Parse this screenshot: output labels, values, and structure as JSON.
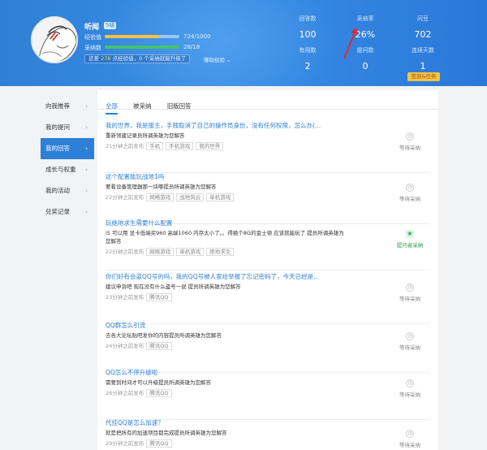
{
  "profile": {
    "username": "听闻",
    "level": "5级",
    "exp_label": "经验值",
    "exp_value": "724/1000",
    "exp_fraction": 0.724,
    "accept_label": "采纳数",
    "accept_value": "28/18",
    "accept_fraction": 1.0,
    "tip_prefix": "还差",
    "tip_number": "276",
    "tip_suffix": "点经验值，0 个采纳就能升级了",
    "tip_link": "赚取经验 ⌄"
  },
  "stats": [
    {
      "label": "回答数",
      "value": "100"
    },
    {
      "label": "采纳率",
      "value": "26%"
    },
    {
      "label": "问豆",
      "value": "702"
    },
    {
      "label": "有用数",
      "value": "2"
    },
    {
      "label": "提问数",
      "value": "0"
    },
    {
      "label": "连续天数",
      "value": "1"
    }
  ],
  "checkin_label": "签到&任务",
  "sidebar": [
    {
      "label": "向我推荐"
    },
    {
      "label": "我的提问"
    },
    {
      "label": "我的回答"
    },
    {
      "label": "成长与权重"
    },
    {
      "label": "我的活动"
    },
    {
      "label": "兑奖记录"
    }
  ],
  "tabs": [
    {
      "label": "全部"
    },
    {
      "label": "被采纳"
    },
    {
      "label": "旧版回答"
    }
  ],
  "questions": [
    {
      "title": "我的世界，我是服主，手贱取消了自己的操作员身份，没有任何权限，怎么办(...",
      "body": "重新领建记录员所调英雄为您解答",
      "time": "21分钟之前发布",
      "tags": [
        "手机",
        "手机游戏",
        "我的世界"
      ],
      "status": "等待采纳",
      "status_icon": "clock-icon",
      "accepted": false
    },
    {
      "title": "这个配置能玩战地1吗",
      "body": "要看设备管理器那一块哪提员所调英雄为您解答",
      "time": "22分钟之前发布",
      "tags": [
        "网络游戏",
        "战地风云",
        "单机游戏"
      ],
      "status": "等待采纳",
      "status_icon": "clock-icon",
      "accepted": false
    },
    {
      "title": "玩绝地求生需要什么配置",
      "body": "i5 可以用 显卡低端买960 高端1060 内存太小了。。得换个8G的金士顿 应该就能玩了 提员所调英雄为您解答",
      "time": "22分钟之前发布",
      "tags": [
        "网络游戏",
        "单机游戏",
        "绝地求生"
      ],
      "status": "提问者采纳",
      "status_icon": "star-icon",
      "accepted": true
    },
    {
      "title": "你们好有会盗QQ号的吗，我的QQ号被人家给举报了忘记密码了，今天已经是...",
      "body": "建议申诉吧 现在没有什么盗号一说 提员所调英雄为您解答",
      "time": "23分钟之前发布",
      "tags": [
        "腾讯QQ"
      ],
      "status": "等待采纳",
      "status_icon": "clock-icon",
      "accepted": false
    },
    {
      "title": "QQ群怎么引流",
      "body": "去各大论坛贴吧发你的内容提员所调英雄为您解答",
      "time": "24分钟之前发布",
      "tags": [
        "腾讯QQ"
      ],
      "status": "等待采纳",
      "status_icon": "clock-icon",
      "accepted": false
    },
    {
      "title": "QQ怎么不停升级啦",
      "body": "需要到时间才可以升级提员所调英雄为您解答",
      "time": "26分钟之前发布",
      "tags": [
        "腾讯QQ"
      ],
      "status": "等待采纳",
      "status_icon": "clock-icon",
      "accepted": false
    },
    {
      "title": "代挂QQ是怎么加速？",
      "body": "就是把所有的加速项目都完成提员所调英雄为您解答",
      "time": "29分钟之前发布",
      "tags": [
        "腾讯QQ"
      ],
      "status": "等待采纳",
      "status_icon": "clock-icon",
      "accepted": false
    }
  ],
  "colors": {
    "header": "#2f7fd6",
    "accent": "#2d7fd8",
    "exp_bar": "#f5c242",
    "accept_bar": "#43c26b",
    "accepted": "#2ca24a"
  }
}
